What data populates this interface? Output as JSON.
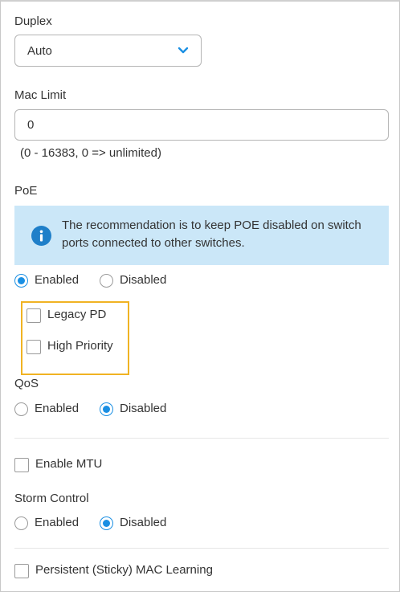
{
  "duplex": {
    "label": "Duplex",
    "value": "Auto"
  },
  "mac_limit": {
    "label": "Mac Limit",
    "value": "0",
    "hint": "(0 - 16383, 0 => unlimited)"
  },
  "poe": {
    "label": "PoE",
    "info_text": "The recommendation is to keep POE disabled on switch ports connected to other switches.",
    "options": {
      "enabled": "Enabled",
      "disabled": "Disabled"
    },
    "selected": "enabled",
    "legacy_pd_label": "Legacy PD",
    "high_priority_label": "High Priority"
  },
  "qos": {
    "label": "QoS",
    "options": {
      "enabled": "Enabled",
      "disabled": "Disabled"
    },
    "selected": "disabled"
  },
  "mtu": {
    "label": "Enable MTU"
  },
  "storm_control": {
    "label": "Storm Control",
    "options": {
      "enabled": "Enabled",
      "disabled": "Disabled"
    },
    "selected": "disabled"
  },
  "sticky_mac": {
    "label": "Persistent (Sticky) MAC Learning"
  },
  "colors": {
    "accent": "#1a8fe3",
    "info_bg": "#cbe7f8",
    "highlight": "#f0b323"
  },
  "icons": {
    "dropdown": "chevron-down-icon",
    "info": "info-icon"
  }
}
